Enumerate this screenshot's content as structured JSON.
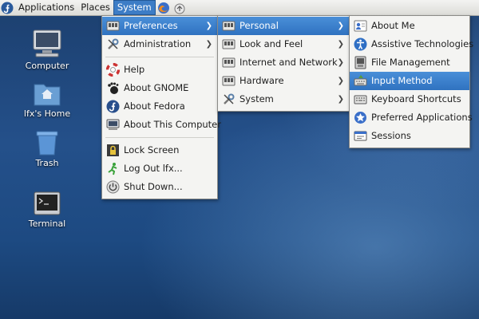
{
  "panel": {
    "applications": "Applications",
    "places": "Places",
    "system": "System"
  },
  "desktop": [
    {
      "label": "Computer",
      "icon": "computer-icon"
    },
    {
      "label": "lfx's Home",
      "icon": "home-folder-icon"
    },
    {
      "label": "Trash",
      "icon": "trash-icon"
    },
    {
      "label": "Terminal",
      "icon": "terminal-icon"
    }
  ],
  "system_menu": {
    "items": [
      {
        "label": "Preferences",
        "icon": "preferences-icon",
        "submenu": true,
        "selected": true
      },
      {
        "label": "Administration",
        "icon": "administration-icon",
        "submenu": true
      },
      {
        "label": "Help",
        "icon": "help-icon"
      },
      {
        "label": "About GNOME",
        "icon": "gnome-foot-icon"
      },
      {
        "label": "About Fedora",
        "icon": "fedora-icon"
      },
      {
        "label": "About This Computer",
        "icon": "computer-small-icon"
      },
      {
        "label": "Lock Screen",
        "icon": "lock-icon"
      },
      {
        "label": "Log Out lfx...",
        "icon": "logout-icon"
      },
      {
        "label": "Shut Down...",
        "icon": "shutdown-icon"
      }
    ]
  },
  "preferences_menu": {
    "items": [
      {
        "label": "Personal",
        "icon": "personal-icon",
        "submenu": true,
        "selected": true
      },
      {
        "label": "Look and Feel",
        "icon": "look-feel-icon",
        "submenu": true
      },
      {
        "label": "Internet and Network",
        "icon": "network-icon",
        "submenu": true
      },
      {
        "label": "Hardware",
        "icon": "hardware-icon",
        "submenu": true
      },
      {
        "label": "System",
        "icon": "system-tools-icon",
        "submenu": true
      }
    ]
  },
  "personal_menu": {
    "items": [
      {
        "label": "About Me",
        "icon": "about-me-icon"
      },
      {
        "label": "Assistive Technologies",
        "icon": "accessibility-icon"
      },
      {
        "label": "File Management",
        "icon": "file-management-icon"
      },
      {
        "label": "Input Method",
        "icon": "input-method-icon",
        "selected": true
      },
      {
        "label": "Keyboard Shortcuts",
        "icon": "keyboard-icon"
      },
      {
        "label": "Preferred Applications",
        "icon": "preferred-apps-icon"
      },
      {
        "label": "Sessions",
        "icon": "sessions-icon"
      }
    ]
  }
}
